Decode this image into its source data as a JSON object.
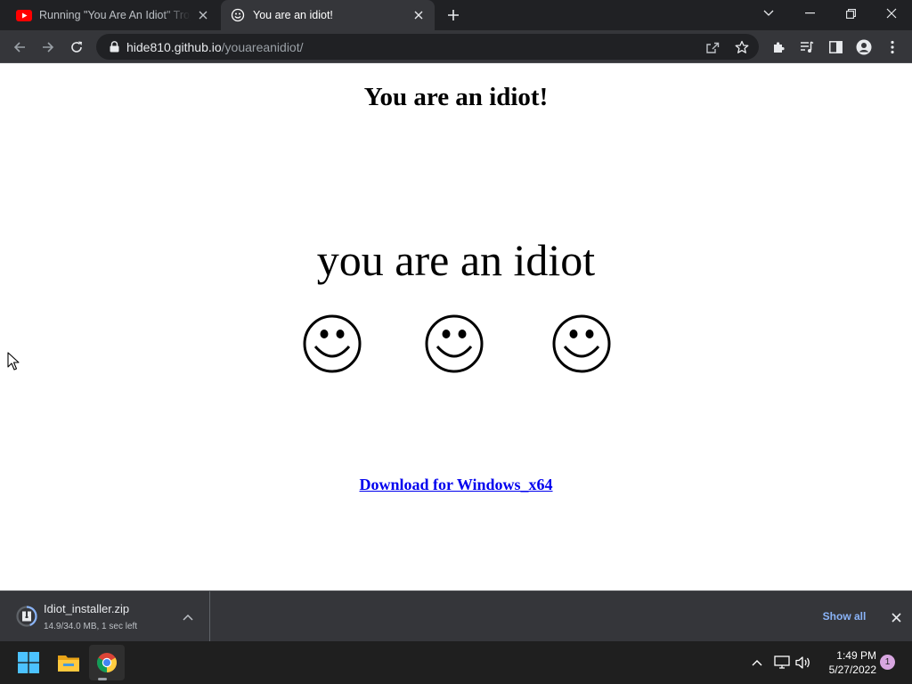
{
  "browser": {
    "tabs": [
      {
        "title": "Running \"You Are An Idiot\" Trojan",
        "favicon": "youtube-icon",
        "active": false
      },
      {
        "title": "You are an idiot!",
        "favicon": "smiley-favicon-icon",
        "active": true
      }
    ],
    "url": {
      "host": "hide810.github.io",
      "path": "/youareanidiot/"
    }
  },
  "page": {
    "heading": "You are an idiot!",
    "big_text": "you are an idiot",
    "smiley_count": 3,
    "download_link": "Download for Windows_x64"
  },
  "download_shelf": {
    "file_name": "Idiot_installer.zip",
    "status": "14.9/34.0 MB, 1 sec left",
    "progress": 0.44,
    "show_all": "Show all"
  },
  "taskbar": {
    "time": "1:49 PM",
    "date": "5/27/2022",
    "notification_count": "1"
  },
  "colors": {
    "tab_bar": "#202124",
    "toolbar": "#35363a",
    "link": "#0000ee",
    "show_all": "#8ab4f8",
    "taskbar": "#1f1f1f"
  }
}
